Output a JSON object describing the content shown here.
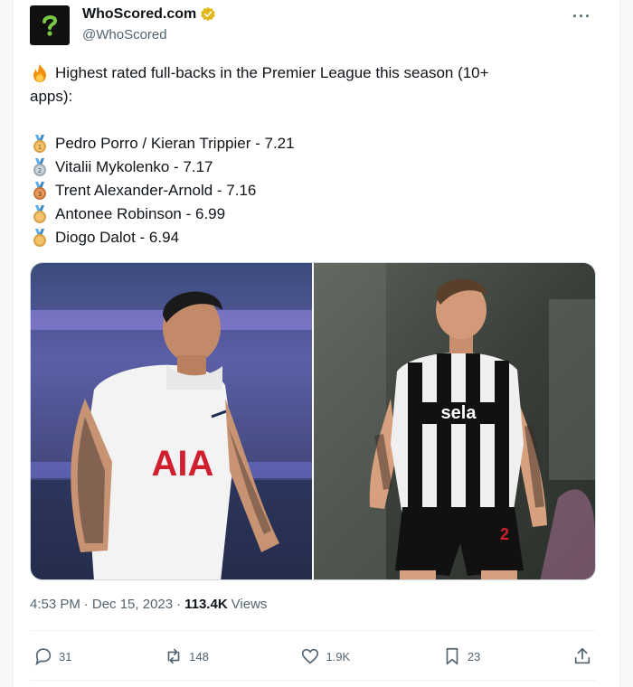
{
  "account": {
    "name": "WhoScored.com",
    "handle": "@WhoScored"
  },
  "tweet": {
    "intro_line1": "Highest rated full-backs in the Premier League this season (10+",
    "intro_line2": "apps):",
    "ranking": [
      {
        "medal": "1",
        "text": "Pedro Porro / Kieran Trippier - 7.21",
        "color": "#d6a24a"
      },
      {
        "medal": "2",
        "text": "Vitalii Mykolenko - 7.17",
        "color": "#9ea9b5"
      },
      {
        "medal": "3",
        "text": "Trent Alexander-Arnold - 7.16",
        "color": "#c8763c"
      },
      {
        "medal": "",
        "text": "Antonee Robinson - 6.99",
        "color": "#d6a24a"
      },
      {
        "medal": "",
        "text": "Diogo Dalot - 6.94",
        "color": "#d6a24a"
      }
    ]
  },
  "media": {
    "left_shirt_text": "AIA",
    "right_shirt_text": "sela",
    "right_number": "2"
  },
  "meta": {
    "time": "4:53 PM",
    "date": "Dec 15, 2023",
    "views_count": "113.4K",
    "views_label": "Views"
  },
  "actions": {
    "replies": "31",
    "reposts": "148",
    "likes": "1.9K",
    "bookmarks": "23"
  },
  "colors": {
    "text": "#0f1419",
    "muted": "#536471",
    "verified": "#e2b719",
    "spurs_red": "#d01f2f"
  }
}
